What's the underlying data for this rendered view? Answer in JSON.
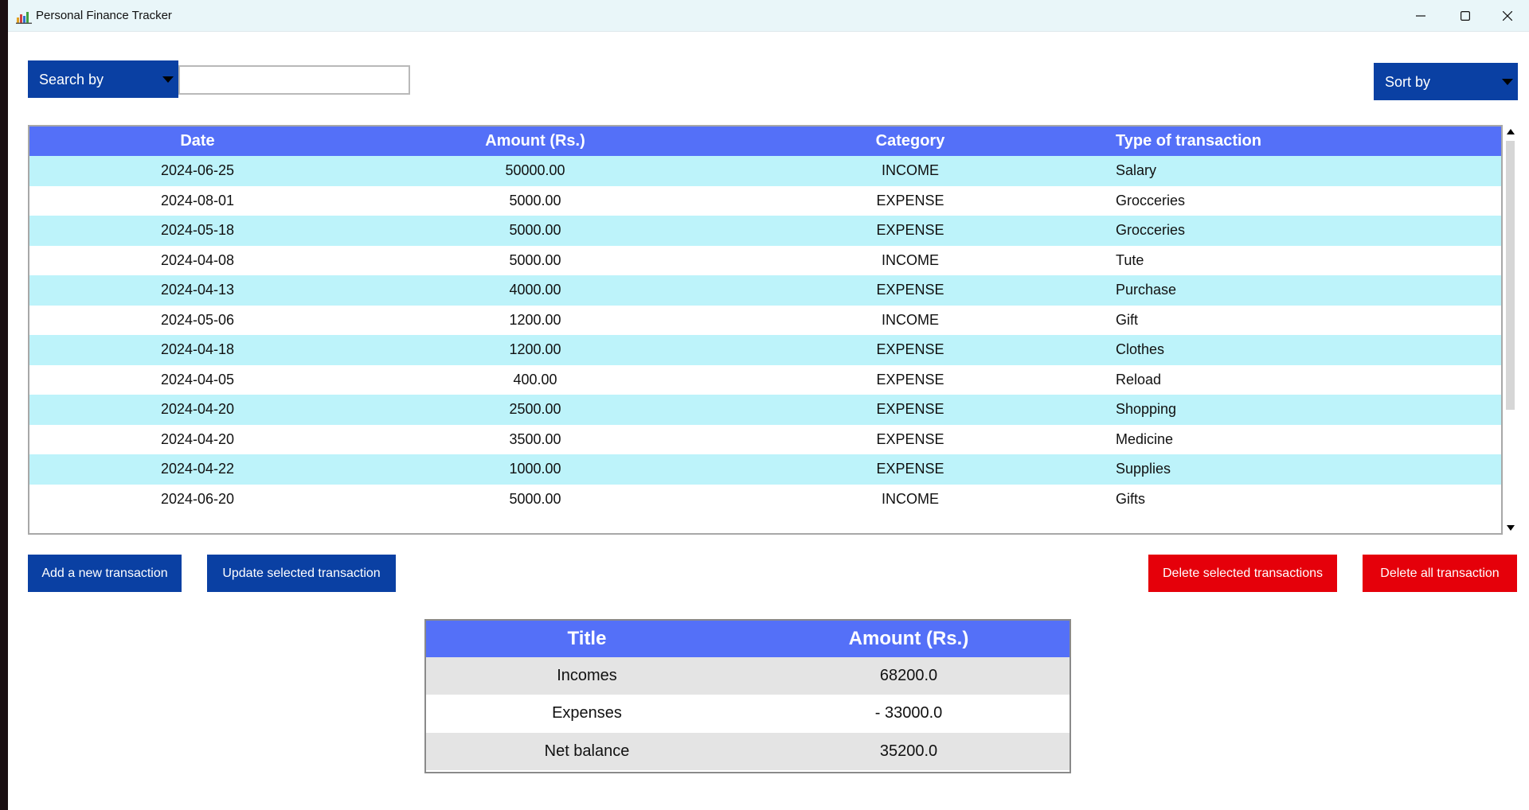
{
  "window": {
    "title": "Personal Finance Tracker"
  },
  "controls": {
    "search_by_label": "Search by",
    "search_value": "",
    "sort_by_label": "Sort by"
  },
  "transactions": {
    "columns": [
      "Date",
      "Amount (Rs.)",
      "Category",
      "Type of transaction"
    ],
    "rows": [
      [
        "2024-06-25",
        "50000.00",
        "INCOME",
        "Salary"
      ],
      [
        "2024-08-01",
        "5000.00",
        "EXPENSE",
        "Grocceries"
      ],
      [
        "2024-05-18",
        "5000.00",
        "EXPENSE",
        "Grocceries"
      ],
      [
        "2024-04-08",
        "5000.00",
        "INCOME",
        "Tute"
      ],
      [
        "2024-04-13",
        "4000.00",
        "EXPENSE",
        "Purchase"
      ],
      [
        "2024-05-06",
        "1200.00",
        "INCOME",
        "Gift"
      ],
      [
        "2024-04-18",
        "1200.00",
        "EXPENSE",
        "Clothes"
      ],
      [
        "2024-04-05",
        "400.00",
        "EXPENSE",
        "Reload"
      ],
      [
        "2024-04-20",
        "2500.00",
        "EXPENSE",
        "Shopping"
      ],
      [
        "2024-04-20",
        "3500.00",
        "EXPENSE",
        "Medicine"
      ],
      [
        "2024-04-22",
        "1000.00",
        "EXPENSE",
        "Supplies"
      ],
      [
        "2024-06-20",
        "5000.00",
        "INCOME",
        "Gifts"
      ]
    ]
  },
  "buttons": {
    "add": "Add a new transaction",
    "update": "Update selected transaction",
    "delete_selected": "Delete selected transactions",
    "delete_all": "Delete all transaction"
  },
  "summary": {
    "columns": [
      "Title",
      "Amount (Rs.)"
    ],
    "rows": [
      [
        "Incomes",
        "68200.0"
      ],
      [
        "Expenses",
        "- 33000.0"
      ],
      [
        "Net balance",
        "35200.0"
      ]
    ]
  },
  "colors": {
    "header_blue": "#5470f8",
    "button_blue": "#0a40a3",
    "button_red": "#e5000a",
    "row_stripe": "#bdf3fa",
    "summary_stripe": "#e4e4e4"
  }
}
